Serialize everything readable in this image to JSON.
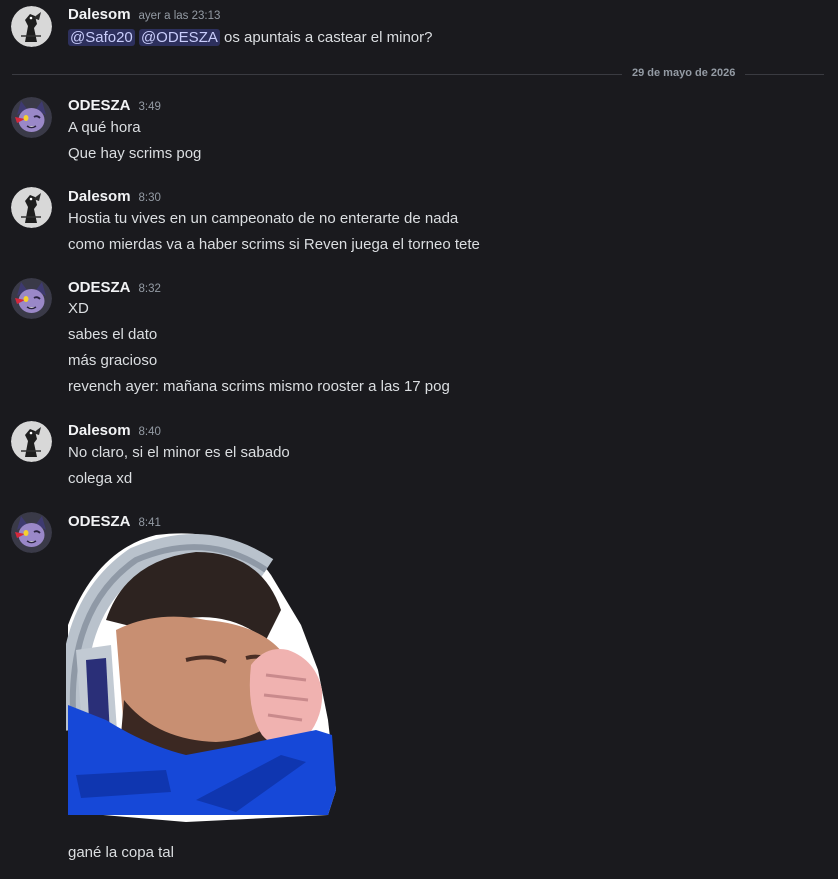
{
  "messages": [
    {
      "author": "Dalesom",
      "time": "ayer a las 23:13",
      "mentions": [
        "@Safo20",
        "@ODESZA"
      ],
      "text": "os apuntais a castear el minor?"
    },
    {
      "author": "ODESZA",
      "time": "3:49",
      "lines": [
        "A qué hora",
        "Que hay scrims pog"
      ]
    },
    {
      "author": "Dalesom",
      "time": "8:30",
      "lines": [
        "Hostia tu vives en un campeonato de no enterarte de nada",
        "como mierdas va a haber scrims si Reven juega el torneo tete"
      ]
    },
    {
      "author": "ODESZA",
      "time": "8:32",
      "lines": [
        "XD",
        "sabes el dato",
        "más gracioso",
        "revench ayer: mañana scrims mismo rooster a las 17 pog"
      ]
    },
    {
      "author": "Dalesom",
      "time": "8:40",
      "lines": [
        "No claro, si el minor es el sabado",
        "colega xd"
      ]
    },
    {
      "author": "ODESZA",
      "time": "8:41",
      "lines": [
        "gané la copa tal"
      ]
    }
  ],
  "date_divider": "29 de mayo de 2026",
  "colors": {
    "background": "#1a1a1e",
    "text": "#dbdee1",
    "username": "#f2f3f5",
    "timestamp": "#949ba4",
    "mention_bg": "#3c3f7a",
    "mention_text": "#c9cdfb"
  }
}
